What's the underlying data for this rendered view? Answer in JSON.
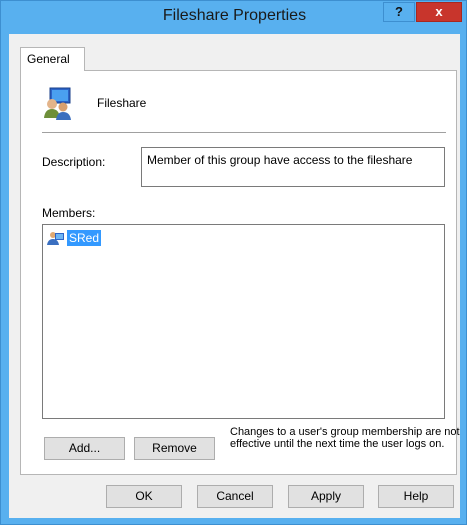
{
  "window": {
    "title": "Fileshare Properties",
    "help_button": "?",
    "close_button": "x"
  },
  "tabs": [
    {
      "label": "General"
    }
  ],
  "group": {
    "name": "Fileshare",
    "icon": "group-users-icon"
  },
  "description": {
    "label": "Description:",
    "value": "Member of this group have access to the fileshare"
  },
  "members": {
    "label": "Members:",
    "items": [
      {
        "name": "SRed",
        "icon": "user-icon",
        "selected": true
      }
    ]
  },
  "buttons": {
    "add": "Add...",
    "remove": "Remove",
    "ok": "OK",
    "cancel": "Cancel",
    "apply": "Apply",
    "help": "Help"
  },
  "note": "Changes to a user's group membership are not effective until the next time the user logs on.",
  "colors": {
    "titlebar": "#58b0ef",
    "close": "#c8352c",
    "selection": "#3399ff"
  }
}
